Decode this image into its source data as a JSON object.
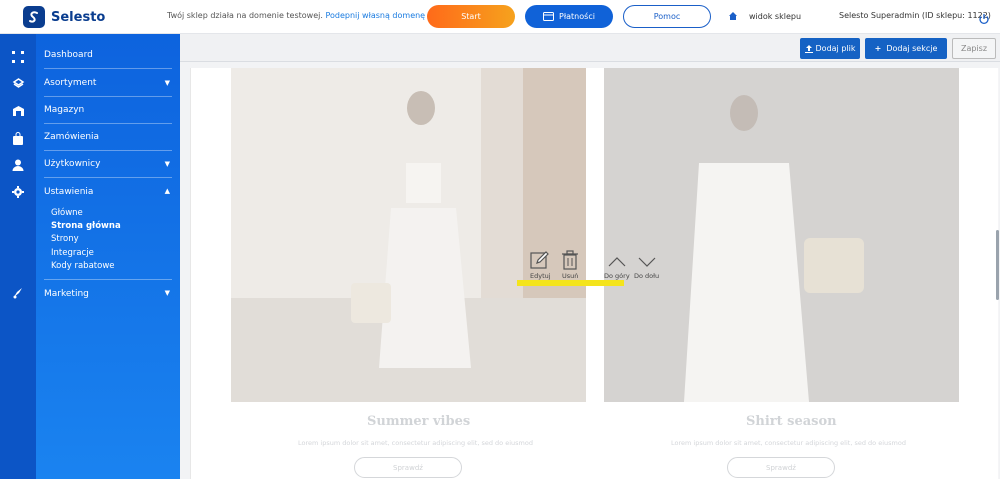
{
  "app": {
    "name": "Selesto"
  },
  "topbar": {
    "notice_text": "Twój sklep działa na domenie testowej.",
    "notice_link": "Podepnij własną domenę",
    "start_label": "Start",
    "payments_label": "Płatności",
    "help_label": "Pomoc",
    "shop_view_label": "widok sklepu",
    "user_label": "Selesto Superadmin (ID sklepu: 1122)"
  },
  "sidebar": {
    "items": [
      {
        "label": "Dashboard",
        "icon": "dashboard-icon"
      },
      {
        "label": "Asortyment",
        "icon": "assortment-icon",
        "expandable": true
      },
      {
        "label": "Magazyn",
        "icon": "warehouse-icon"
      },
      {
        "label": "Zamówienia",
        "icon": "orders-bag-icon"
      },
      {
        "label": "Użytkownicy",
        "icon": "user-icon",
        "expandable": true
      },
      {
        "label": "Ustawienia",
        "icon": "gear-icon",
        "expandable": true,
        "expanded": true
      },
      {
        "label": "Marketing",
        "icon": "marketing-icon",
        "expandable": true
      }
    ],
    "settings_submenu": [
      {
        "label": "Główne",
        "active": false
      },
      {
        "label": "Strona główna",
        "active": true
      },
      {
        "label": "Strony",
        "active": false
      },
      {
        "label": "Integracje",
        "active": false
      },
      {
        "label": "Kody rabatowe",
        "active": false
      }
    ]
  },
  "actionbar": {
    "upload_label": "Dodaj plik",
    "add_section_label": "Dodaj sekcje",
    "save_label": "Zapisz"
  },
  "banners": [
    {
      "title": "Summer vibes",
      "description": "Lorem ipsum dolor sit amet, consectetur adipiscing elit, sed do eiusmod",
      "button": "Sprawdź"
    },
    {
      "title": "Shirt season",
      "description": "Lorem ipsum dolor sit amet, consectetur adipiscing elit, sed do eiusmod",
      "button": "Sprawdź"
    }
  ],
  "section_tools": {
    "edit": "Edytuj",
    "delete": "Usuń",
    "move_up": "Do góry",
    "move_down": "Do dołu"
  },
  "colors": {
    "brand_blue": "#0c55c6",
    "sidebar_gradient_end": "#1a83f0",
    "start_orange": "#ff6a1a",
    "highlight_yellow": "#f4e41c"
  }
}
